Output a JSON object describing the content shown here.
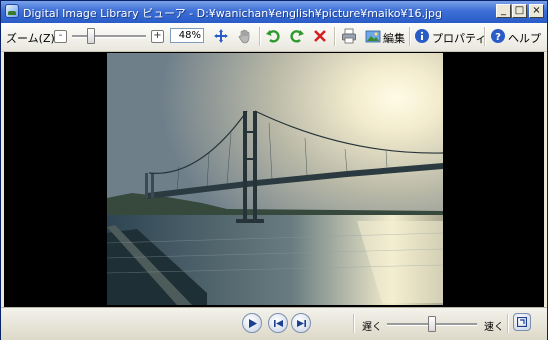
{
  "window": {
    "title": "Digital Image Library ビューア - D:¥wanichan¥english¥picture¥maiko¥16.jpg",
    "minimize_label": "_",
    "maximize_label": "□",
    "close_label": "×"
  },
  "toolbar": {
    "zoom_label": "ズーム(Z)",
    "zoom_out_label": "-",
    "zoom_in_label": "+",
    "zoom_value": "48%",
    "zoom_level": 0.25,
    "edit_label": "編集",
    "properties_label": "プロパティ",
    "help_label": "ヘルプ",
    "icons": [
      "move-icon",
      "pan-hand-icon",
      "rotate-left-icon",
      "rotate-right-icon",
      "delete-icon",
      "print-icon",
      "edit-icon",
      "properties-icon",
      "help-icon"
    ],
    "colors": {
      "rotate": "#2e9a2e",
      "delete": "#d42020",
      "info": "#2a5cc8"
    }
  },
  "controls": {
    "slow_label": "遅く",
    "fast_label": "速く",
    "speed_level": 0.5,
    "icons": [
      "play-icon",
      "previous-icon",
      "next-icon",
      "fullscreen-icon"
    ]
  }
}
